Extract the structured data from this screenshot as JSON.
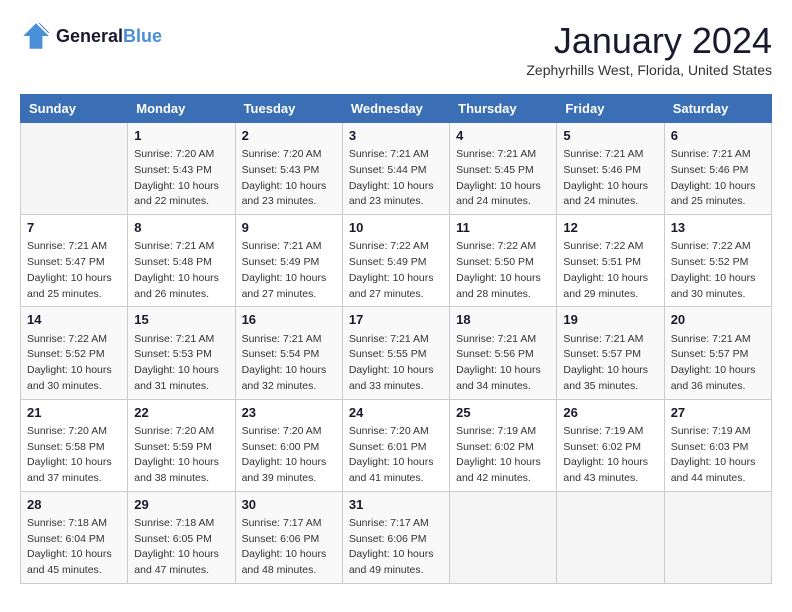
{
  "logo": {
    "line1": "General",
    "line2": "Blue"
  },
  "title": "January 2024",
  "location": "Zephyrhills West, Florida, United States",
  "days_of_week": [
    "Sunday",
    "Monday",
    "Tuesday",
    "Wednesday",
    "Thursday",
    "Friday",
    "Saturday"
  ],
  "weeks": [
    [
      {
        "day": "",
        "sunrise": "",
        "sunset": "",
        "daylight": ""
      },
      {
        "day": "1",
        "sunrise": "Sunrise: 7:20 AM",
        "sunset": "Sunset: 5:43 PM",
        "daylight": "Daylight: 10 hours and 22 minutes."
      },
      {
        "day": "2",
        "sunrise": "Sunrise: 7:20 AM",
        "sunset": "Sunset: 5:43 PM",
        "daylight": "Daylight: 10 hours and 23 minutes."
      },
      {
        "day": "3",
        "sunrise": "Sunrise: 7:21 AM",
        "sunset": "Sunset: 5:44 PM",
        "daylight": "Daylight: 10 hours and 23 minutes."
      },
      {
        "day": "4",
        "sunrise": "Sunrise: 7:21 AM",
        "sunset": "Sunset: 5:45 PM",
        "daylight": "Daylight: 10 hours and 24 minutes."
      },
      {
        "day": "5",
        "sunrise": "Sunrise: 7:21 AM",
        "sunset": "Sunset: 5:46 PM",
        "daylight": "Daylight: 10 hours and 24 minutes."
      },
      {
        "day": "6",
        "sunrise": "Sunrise: 7:21 AM",
        "sunset": "Sunset: 5:46 PM",
        "daylight": "Daylight: 10 hours and 25 minutes."
      }
    ],
    [
      {
        "day": "7",
        "sunrise": "Sunrise: 7:21 AM",
        "sunset": "Sunset: 5:47 PM",
        "daylight": "Daylight: 10 hours and 25 minutes."
      },
      {
        "day": "8",
        "sunrise": "Sunrise: 7:21 AM",
        "sunset": "Sunset: 5:48 PM",
        "daylight": "Daylight: 10 hours and 26 minutes."
      },
      {
        "day": "9",
        "sunrise": "Sunrise: 7:21 AM",
        "sunset": "Sunset: 5:49 PM",
        "daylight": "Daylight: 10 hours and 27 minutes."
      },
      {
        "day": "10",
        "sunrise": "Sunrise: 7:22 AM",
        "sunset": "Sunset: 5:49 PM",
        "daylight": "Daylight: 10 hours and 27 minutes."
      },
      {
        "day": "11",
        "sunrise": "Sunrise: 7:22 AM",
        "sunset": "Sunset: 5:50 PM",
        "daylight": "Daylight: 10 hours and 28 minutes."
      },
      {
        "day": "12",
        "sunrise": "Sunrise: 7:22 AM",
        "sunset": "Sunset: 5:51 PM",
        "daylight": "Daylight: 10 hours and 29 minutes."
      },
      {
        "day": "13",
        "sunrise": "Sunrise: 7:22 AM",
        "sunset": "Sunset: 5:52 PM",
        "daylight": "Daylight: 10 hours and 30 minutes."
      }
    ],
    [
      {
        "day": "14",
        "sunrise": "Sunrise: 7:22 AM",
        "sunset": "Sunset: 5:52 PM",
        "daylight": "Daylight: 10 hours and 30 minutes."
      },
      {
        "day": "15",
        "sunrise": "Sunrise: 7:21 AM",
        "sunset": "Sunset: 5:53 PM",
        "daylight": "Daylight: 10 hours and 31 minutes."
      },
      {
        "day": "16",
        "sunrise": "Sunrise: 7:21 AM",
        "sunset": "Sunset: 5:54 PM",
        "daylight": "Daylight: 10 hours and 32 minutes."
      },
      {
        "day": "17",
        "sunrise": "Sunrise: 7:21 AM",
        "sunset": "Sunset: 5:55 PM",
        "daylight": "Daylight: 10 hours and 33 minutes."
      },
      {
        "day": "18",
        "sunrise": "Sunrise: 7:21 AM",
        "sunset": "Sunset: 5:56 PM",
        "daylight": "Daylight: 10 hours and 34 minutes."
      },
      {
        "day": "19",
        "sunrise": "Sunrise: 7:21 AM",
        "sunset": "Sunset: 5:57 PM",
        "daylight": "Daylight: 10 hours and 35 minutes."
      },
      {
        "day": "20",
        "sunrise": "Sunrise: 7:21 AM",
        "sunset": "Sunset: 5:57 PM",
        "daylight": "Daylight: 10 hours and 36 minutes."
      }
    ],
    [
      {
        "day": "21",
        "sunrise": "Sunrise: 7:20 AM",
        "sunset": "Sunset: 5:58 PM",
        "daylight": "Daylight: 10 hours and 37 minutes."
      },
      {
        "day": "22",
        "sunrise": "Sunrise: 7:20 AM",
        "sunset": "Sunset: 5:59 PM",
        "daylight": "Daylight: 10 hours and 38 minutes."
      },
      {
        "day": "23",
        "sunrise": "Sunrise: 7:20 AM",
        "sunset": "Sunset: 6:00 PM",
        "daylight": "Daylight: 10 hours and 39 minutes."
      },
      {
        "day": "24",
        "sunrise": "Sunrise: 7:20 AM",
        "sunset": "Sunset: 6:01 PM",
        "daylight": "Daylight: 10 hours and 41 minutes."
      },
      {
        "day": "25",
        "sunrise": "Sunrise: 7:19 AM",
        "sunset": "Sunset: 6:02 PM",
        "daylight": "Daylight: 10 hours and 42 minutes."
      },
      {
        "day": "26",
        "sunrise": "Sunrise: 7:19 AM",
        "sunset": "Sunset: 6:02 PM",
        "daylight": "Daylight: 10 hours and 43 minutes."
      },
      {
        "day": "27",
        "sunrise": "Sunrise: 7:19 AM",
        "sunset": "Sunset: 6:03 PM",
        "daylight": "Daylight: 10 hours and 44 minutes."
      }
    ],
    [
      {
        "day": "28",
        "sunrise": "Sunrise: 7:18 AM",
        "sunset": "Sunset: 6:04 PM",
        "daylight": "Daylight: 10 hours and 45 minutes."
      },
      {
        "day": "29",
        "sunrise": "Sunrise: 7:18 AM",
        "sunset": "Sunset: 6:05 PM",
        "daylight": "Daylight: 10 hours and 47 minutes."
      },
      {
        "day": "30",
        "sunrise": "Sunrise: 7:17 AM",
        "sunset": "Sunset: 6:06 PM",
        "daylight": "Daylight: 10 hours and 48 minutes."
      },
      {
        "day": "31",
        "sunrise": "Sunrise: 7:17 AM",
        "sunset": "Sunset: 6:06 PM",
        "daylight": "Daylight: 10 hours and 49 minutes."
      },
      {
        "day": "",
        "sunrise": "",
        "sunset": "",
        "daylight": ""
      },
      {
        "day": "",
        "sunrise": "",
        "sunset": "",
        "daylight": ""
      },
      {
        "day": "",
        "sunrise": "",
        "sunset": "",
        "daylight": ""
      }
    ]
  ]
}
